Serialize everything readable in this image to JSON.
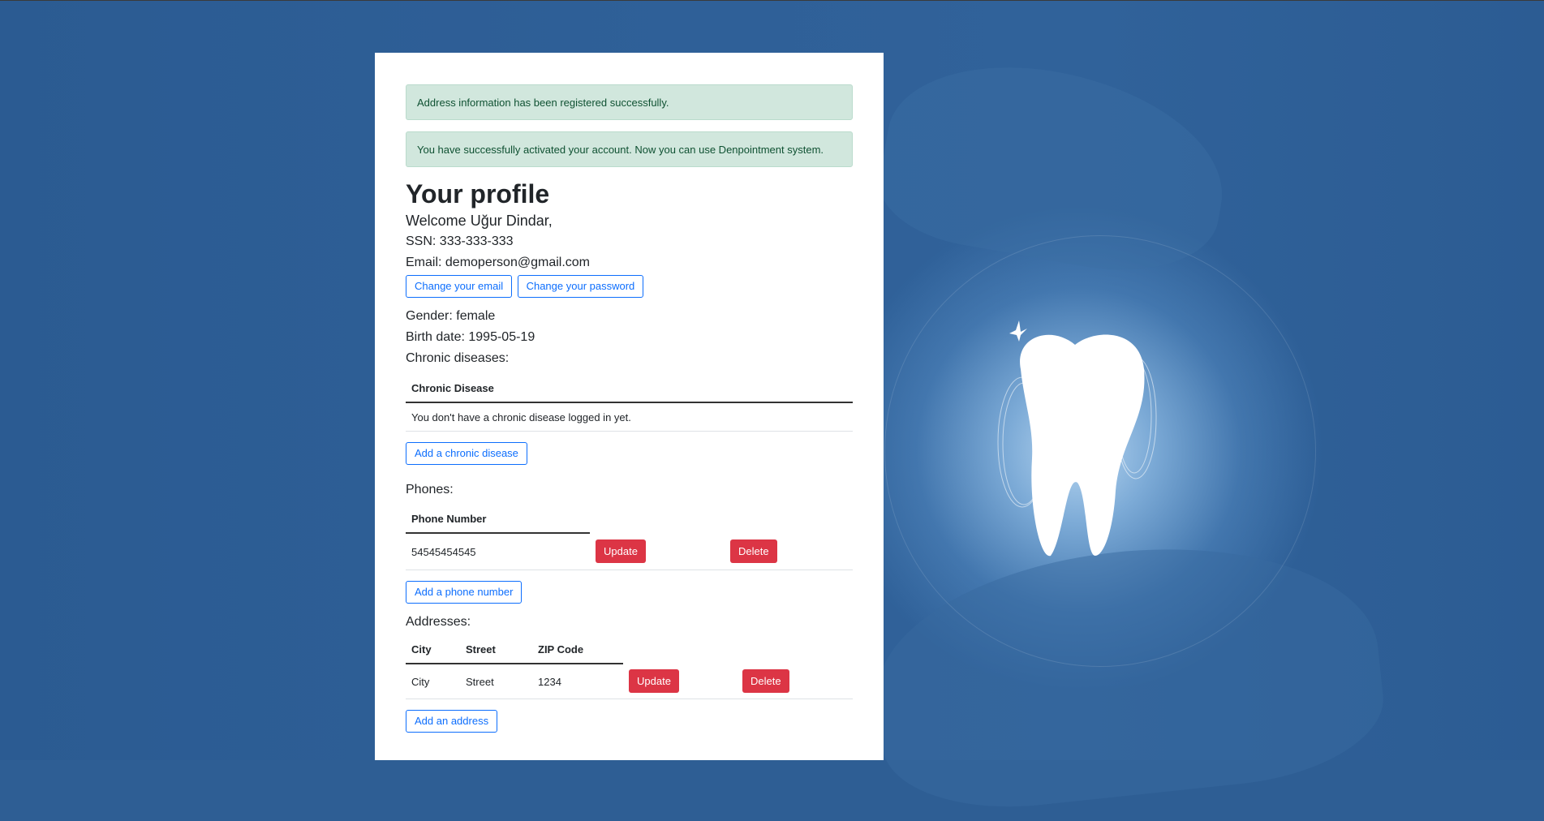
{
  "alerts": [
    "Address information has been registered successfully.",
    "You have successfully activated your account. Now you can use Denpointment system."
  ],
  "profile": {
    "title": "Your profile",
    "welcome": "Welcome Uğur Dindar,",
    "ssn": "SSN: 333-333-333",
    "email": "Email: demoperson@gmail.com",
    "change_email": "Change your email",
    "change_password": "Change your password",
    "gender": "Gender: female",
    "birth_date": "Birth date: 1995-05-19"
  },
  "chronic": {
    "heading": "Chronic diseases:",
    "column": "Chronic Disease",
    "empty": "You don't have a chronic disease logged in yet.",
    "add": "Add a chronic disease"
  },
  "phones": {
    "heading": "Phones:",
    "column": "Phone Number",
    "rows": [
      {
        "number": "54545454545",
        "update": "Update",
        "delete": "Delete"
      }
    ],
    "add": "Add a phone number"
  },
  "addresses": {
    "heading": "Addresses:",
    "columns": [
      "City",
      "Street",
      "ZIP Code"
    ],
    "rows": [
      {
        "city": "City",
        "street": "Street",
        "zip": "1234",
        "update": "Update",
        "delete": "Delete"
      }
    ],
    "add": "Add an address"
  },
  "colors": {
    "primary": "#0d6efd",
    "danger": "#dc3545",
    "success_bg": "#d1e7dd",
    "background": "#2e5e94"
  }
}
